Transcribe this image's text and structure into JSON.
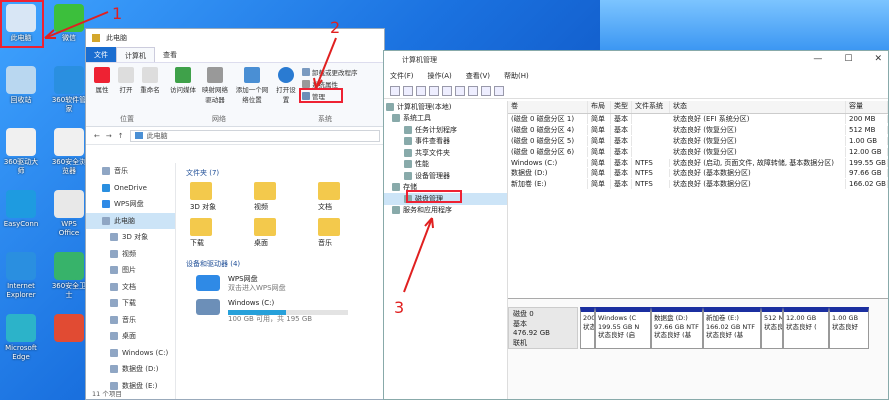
{
  "desktop": {
    "icons": [
      {
        "label": "此电脑",
        "color": "#d8e6f5"
      },
      {
        "label": "微信",
        "color": "#3cbf3c"
      },
      {
        "label": "回收站",
        "color": "#b9d7f0"
      },
      {
        "label": "360软件管家",
        "color": "#2a8fe0"
      },
      {
        "label": "360驱动大师",
        "color": "#f0f0f0"
      },
      {
        "label": "360安全浏览器",
        "color": "#f0f0f0"
      },
      {
        "label": "EasyConn",
        "color": "#1e9be0"
      },
      {
        "label": "WPS Office",
        "color": "#e8e8e8"
      },
      {
        "label": "Internet Explorer",
        "color": "#2a8fe0"
      },
      {
        "label": "360安全卫士",
        "color": "#37b36a"
      },
      {
        "label": "Microsoft Edge",
        "color": "#2cb3c9"
      },
      {
        "label": "",
        "color": "#e14b33"
      }
    ]
  },
  "annotations": {
    "step1": "1",
    "step2": "2",
    "step3": "3"
  },
  "explorer": {
    "title": "此电脑",
    "tabs": [
      "文件",
      "计算机",
      "查看"
    ],
    "ribbon_buttons": [
      "属性",
      "打开",
      "重命名",
      "访问媒体",
      "映射网络驱动器",
      "添加一个网络位置",
      "打开设置"
    ],
    "ribbon_small": [
      "卸载或更改程序",
      "系统属性",
      "管理"
    ],
    "group_labels": [
      "位置",
      "网络",
      "系统"
    ],
    "address": "此电脑",
    "nav_items": [
      "音乐",
      "OneDrive",
      "WPS网盘",
      "此电脑",
      "3D 对象",
      "视频",
      "图片",
      "文档",
      "下载",
      "音乐",
      "桌面",
      "Windows (C:)",
      "数据盘 (D:)",
      "数据盘 (E:)"
    ],
    "section_folders": "文件夹 (7)",
    "folders": [
      "3D 对象",
      "视频",
      "文档",
      "下载",
      "桌面",
      "音乐"
    ],
    "section_devices": "设备和驱动器 (4)",
    "devices": [
      {
        "name": "WPS网盘",
        "sub": "双击进入WPS网盘",
        "color": "#2f8ae6"
      },
      {
        "name": "Windows (C:)",
        "sub": "100 GB 可用，共 195 GB",
        "color": "#6c8fb8",
        "fill": 0.48
      }
    ],
    "footer": "11 个项目"
  },
  "mgmt": {
    "title": "计算机管理",
    "menu": [
      "文件(F)",
      "操作(A)",
      "查看(V)",
      "帮助(H)"
    ],
    "tree": [
      {
        "label": "计算机管理(本地)",
        "indent": 2
      },
      {
        "label": "系统工具",
        "indent": 8
      },
      {
        "label": "任务计划程序",
        "indent": 20
      },
      {
        "label": "事件查看器",
        "indent": 20
      },
      {
        "label": "共享文件夹",
        "indent": 20
      },
      {
        "label": "性能",
        "indent": 20
      },
      {
        "label": "设备管理器",
        "indent": 20
      },
      {
        "label": "存储",
        "indent": 8
      },
      {
        "label": "磁盘管理",
        "indent": 20
      },
      {
        "label": "服务和应用程序",
        "indent": 8
      }
    ],
    "columns": [
      "卷",
      "布局",
      "类型",
      "文件系统",
      "状态",
      "容量"
    ],
    "volumes": [
      [
        "(磁盘 0 磁盘分区 1)",
        "简单",
        "基本",
        "",
        "状态良好 (EFI 系统分区)",
        "200 MB"
      ],
      [
        "(磁盘 0 磁盘分区 4)",
        "简单",
        "基本",
        "",
        "状态良好 (恢复分区)",
        "512 MB"
      ],
      [
        "(磁盘 0 磁盘分区 5)",
        "简单",
        "基本",
        "",
        "状态良好 (恢复分区)",
        "1.00 GB"
      ],
      [
        "(磁盘 0 磁盘分区 6)",
        "简单",
        "基本",
        "",
        "状态良好 (恢复分区)",
        "12.00 GB"
      ],
      [
        "Windows (C:)",
        "简单",
        "基本",
        "NTFS",
        "状态良好 (启动, 页面文件, 故障转储, 基本数据分区)",
        "199.55 GB"
      ],
      [
        "数据盘 (D:)",
        "简单",
        "基本",
        "NTFS",
        "状态良好 (基本数据分区)",
        "97.66 GB"
      ],
      [
        "新加卷 (E:)",
        "简单",
        "基本",
        "NTFS",
        "状态良好 (基本数据分区)",
        "166.02 GB"
      ]
    ],
    "disk": {
      "name": "磁盘 0",
      "type": "基本",
      "size": "476.92 GB",
      "state": "联机"
    },
    "partitions": [
      {
        "l1": "200",
        "l2": "状态",
        "w": 15
      },
      {
        "l1": "Windows (C",
        "l2": "199.55 GB N",
        "l3": "状态良好 (启",
        "w": 56
      },
      {
        "l1": "数据盘 (D:)",
        "l2": "97.66 GB NTF",
        "l3": "状态良好 (基",
        "w": 52
      },
      {
        "l1": "新加卷 (E:)",
        "l2": "166.02 GB NTF",
        "l3": "状态良好 (基",
        "w": 58
      },
      {
        "l1": "512 M",
        "l2": "状态良",
        "w": 22
      },
      {
        "l1": "12.00 GB",
        "l2": "状态良好 (",
        "w": 46
      },
      {
        "l1": "1.00 GB",
        "l2": "状态良好",
        "w": 40
      }
    ]
  }
}
